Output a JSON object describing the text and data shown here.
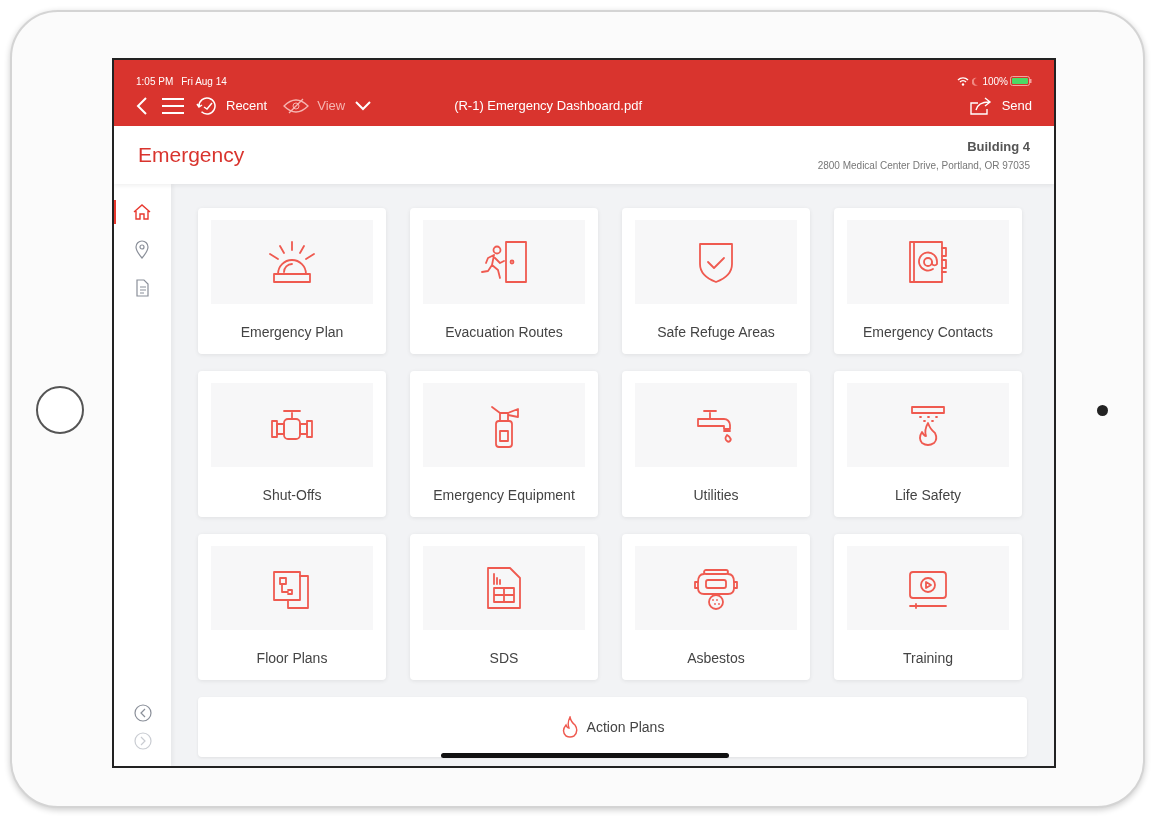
{
  "status_bar": {
    "time": "1:05 PM",
    "date": "Fri Aug 14",
    "battery": "100%"
  },
  "toolbar": {
    "recent": "Recent",
    "view": "View",
    "title": "(R-1) Emergency Dashboard.pdf",
    "send": "Send"
  },
  "header": {
    "title": "Emergency",
    "building": "Building 4",
    "address": "2800 Medical Center Drive, Portland, OR 97035"
  },
  "sidebar": {
    "items": [
      {
        "kind": "home",
        "selected": true
      },
      {
        "kind": "location",
        "selected": false
      },
      {
        "kind": "document",
        "selected": false
      }
    ]
  },
  "tiles": [
    {
      "label": "Emergency Plan",
      "kind": "siren"
    },
    {
      "label": "Evacuation Routes",
      "kind": "exit"
    },
    {
      "label": "Safe Refuge Areas",
      "kind": "shield"
    },
    {
      "label": "Emergency Contacts",
      "kind": "contacts"
    },
    {
      "label": "Shut-Offs",
      "kind": "valve"
    },
    {
      "label": "Emergency Equipment",
      "kind": "extinguisher"
    },
    {
      "label": "Utilities",
      "kind": "faucet"
    },
    {
      "label": "Life Safety",
      "kind": "sprinkler"
    },
    {
      "label": "Floor Plans",
      "kind": "floorplan"
    },
    {
      "label": "SDS",
      "kind": "datasheet"
    },
    {
      "label": "Asbestos",
      "kind": "mask"
    },
    {
      "label": "Training",
      "kind": "video"
    }
  ],
  "action_bar": {
    "label": "Action Plans"
  }
}
